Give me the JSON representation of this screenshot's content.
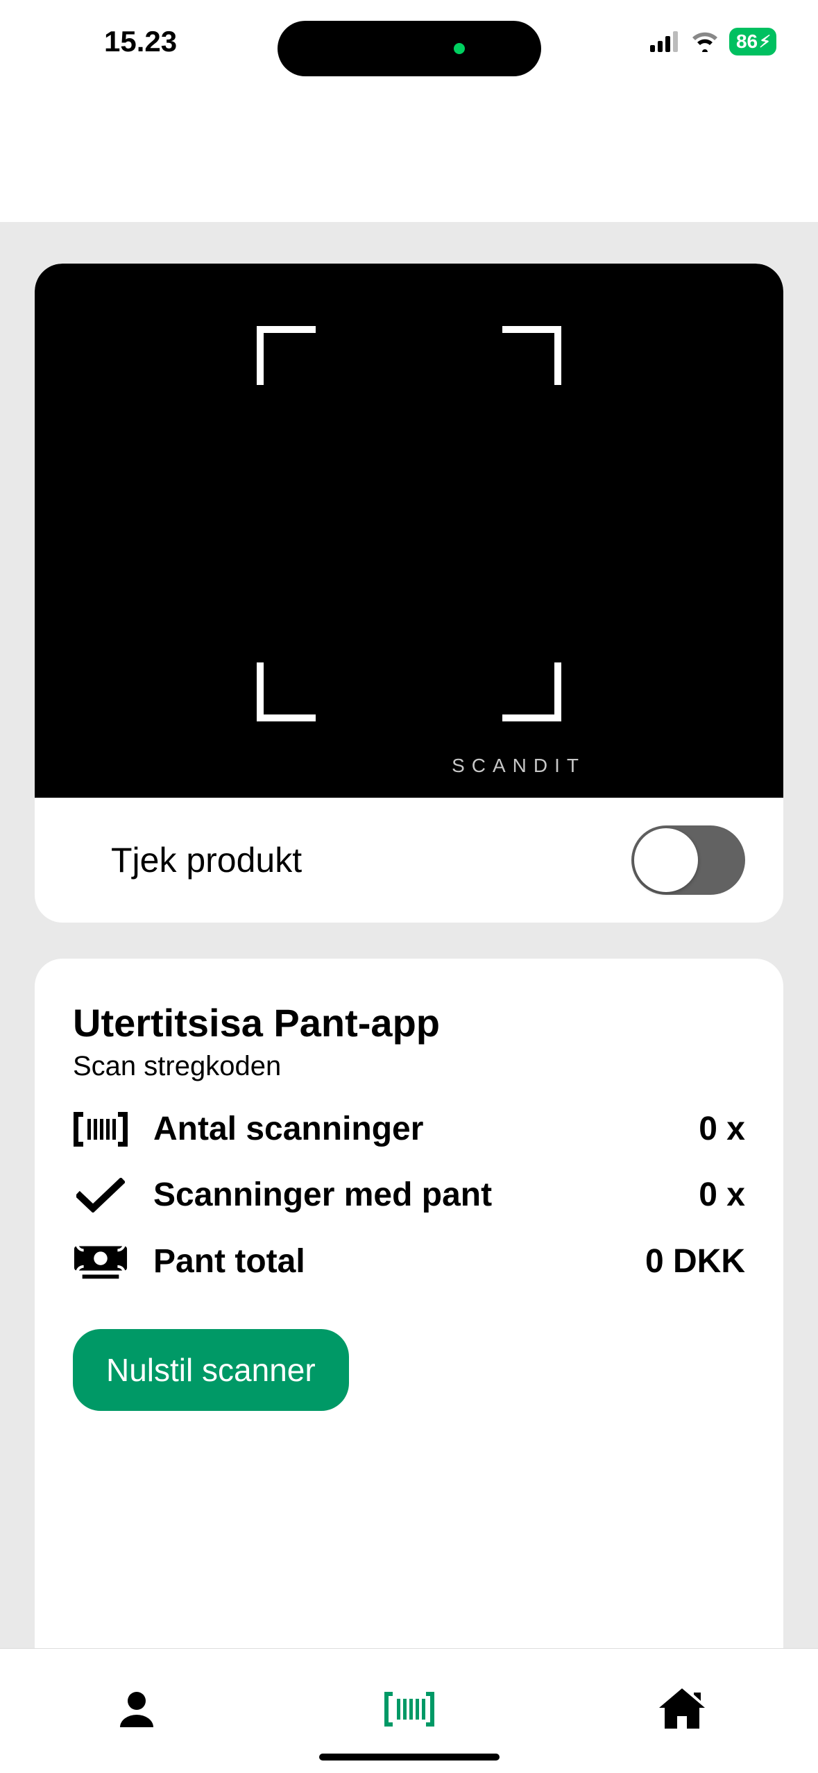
{
  "status": {
    "time": "15.23",
    "battery_pct": "86"
  },
  "scanner": {
    "watermark": "SCANDIT",
    "toggle_label": "Tjek produkt",
    "toggle_on": false
  },
  "stats": {
    "title": "Utertitsisa Pant-app",
    "subtitle": "Scan stregkoden",
    "rows": [
      {
        "label": "Antal scanninger",
        "value": "0 x"
      },
      {
        "label": "Scanninger med pant",
        "value": "0 x"
      },
      {
        "label": "Pant total",
        "value": "0 DKK"
      }
    ],
    "reset_label": "Nulstil scanner"
  },
  "nav": {
    "active_index": 1
  },
  "colors": {
    "accent": "#009966",
    "switch_off": "#626262"
  }
}
